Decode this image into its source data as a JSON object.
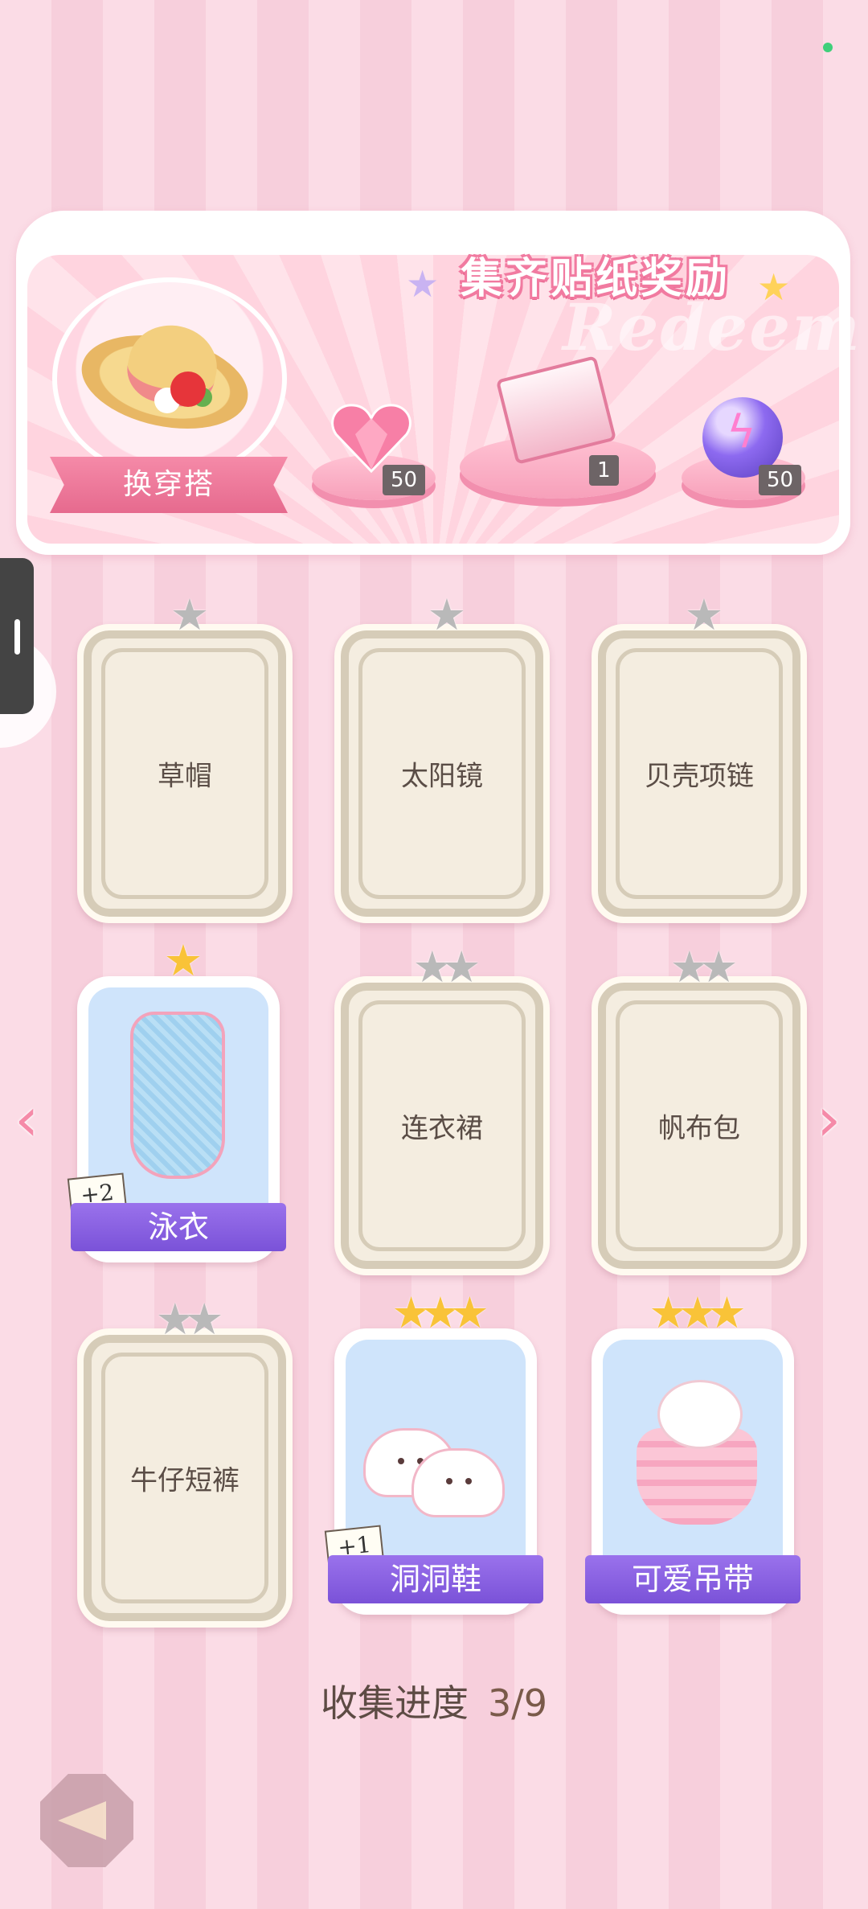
{
  "banner": {
    "title": "集齐贴纸奖励",
    "watermark": "Redeem",
    "outfit_button": "换穿搭",
    "rewards": [
      {
        "icon": "heart-gem-icon",
        "qty": "50"
      },
      {
        "icon": "gift-box-icon",
        "qty": "1"
      },
      {
        "icon": "lightning-orb-icon",
        "qty": "50"
      }
    ]
  },
  "cards": [
    {
      "name": "草帽",
      "stars": 1,
      "star_color": "grey",
      "owned": false
    },
    {
      "name": "太阳镜",
      "stars": 1,
      "star_color": "grey",
      "owned": false
    },
    {
      "name": "贝壳项链",
      "stars": 1,
      "star_color": "grey",
      "owned": false
    },
    {
      "name": "泳衣",
      "stars": 1,
      "star_color": "gold",
      "owned": true,
      "extra": "+2"
    },
    {
      "name": "连衣裙",
      "stars": 2,
      "star_color": "grey",
      "owned": false
    },
    {
      "name": "帆布包",
      "stars": 2,
      "star_color": "grey",
      "owned": false
    },
    {
      "name": "牛仔短裤",
      "stars": 2,
      "star_color": "grey",
      "owned": false
    },
    {
      "name": "洞洞鞋",
      "stars": 3,
      "star_color": "gold",
      "owned": true,
      "extra": "+1"
    },
    {
      "name": "可爱吊带",
      "stars": 3,
      "star_color": "gold",
      "owned": true
    }
  ],
  "progress": {
    "label": "收集进度",
    "value": "3/9"
  },
  "colors": {
    "accent": "#f58aa8",
    "ribbon": "#8a62e2",
    "star_gold": "#f9c338",
    "star_grey": "#b9b9b9"
  }
}
